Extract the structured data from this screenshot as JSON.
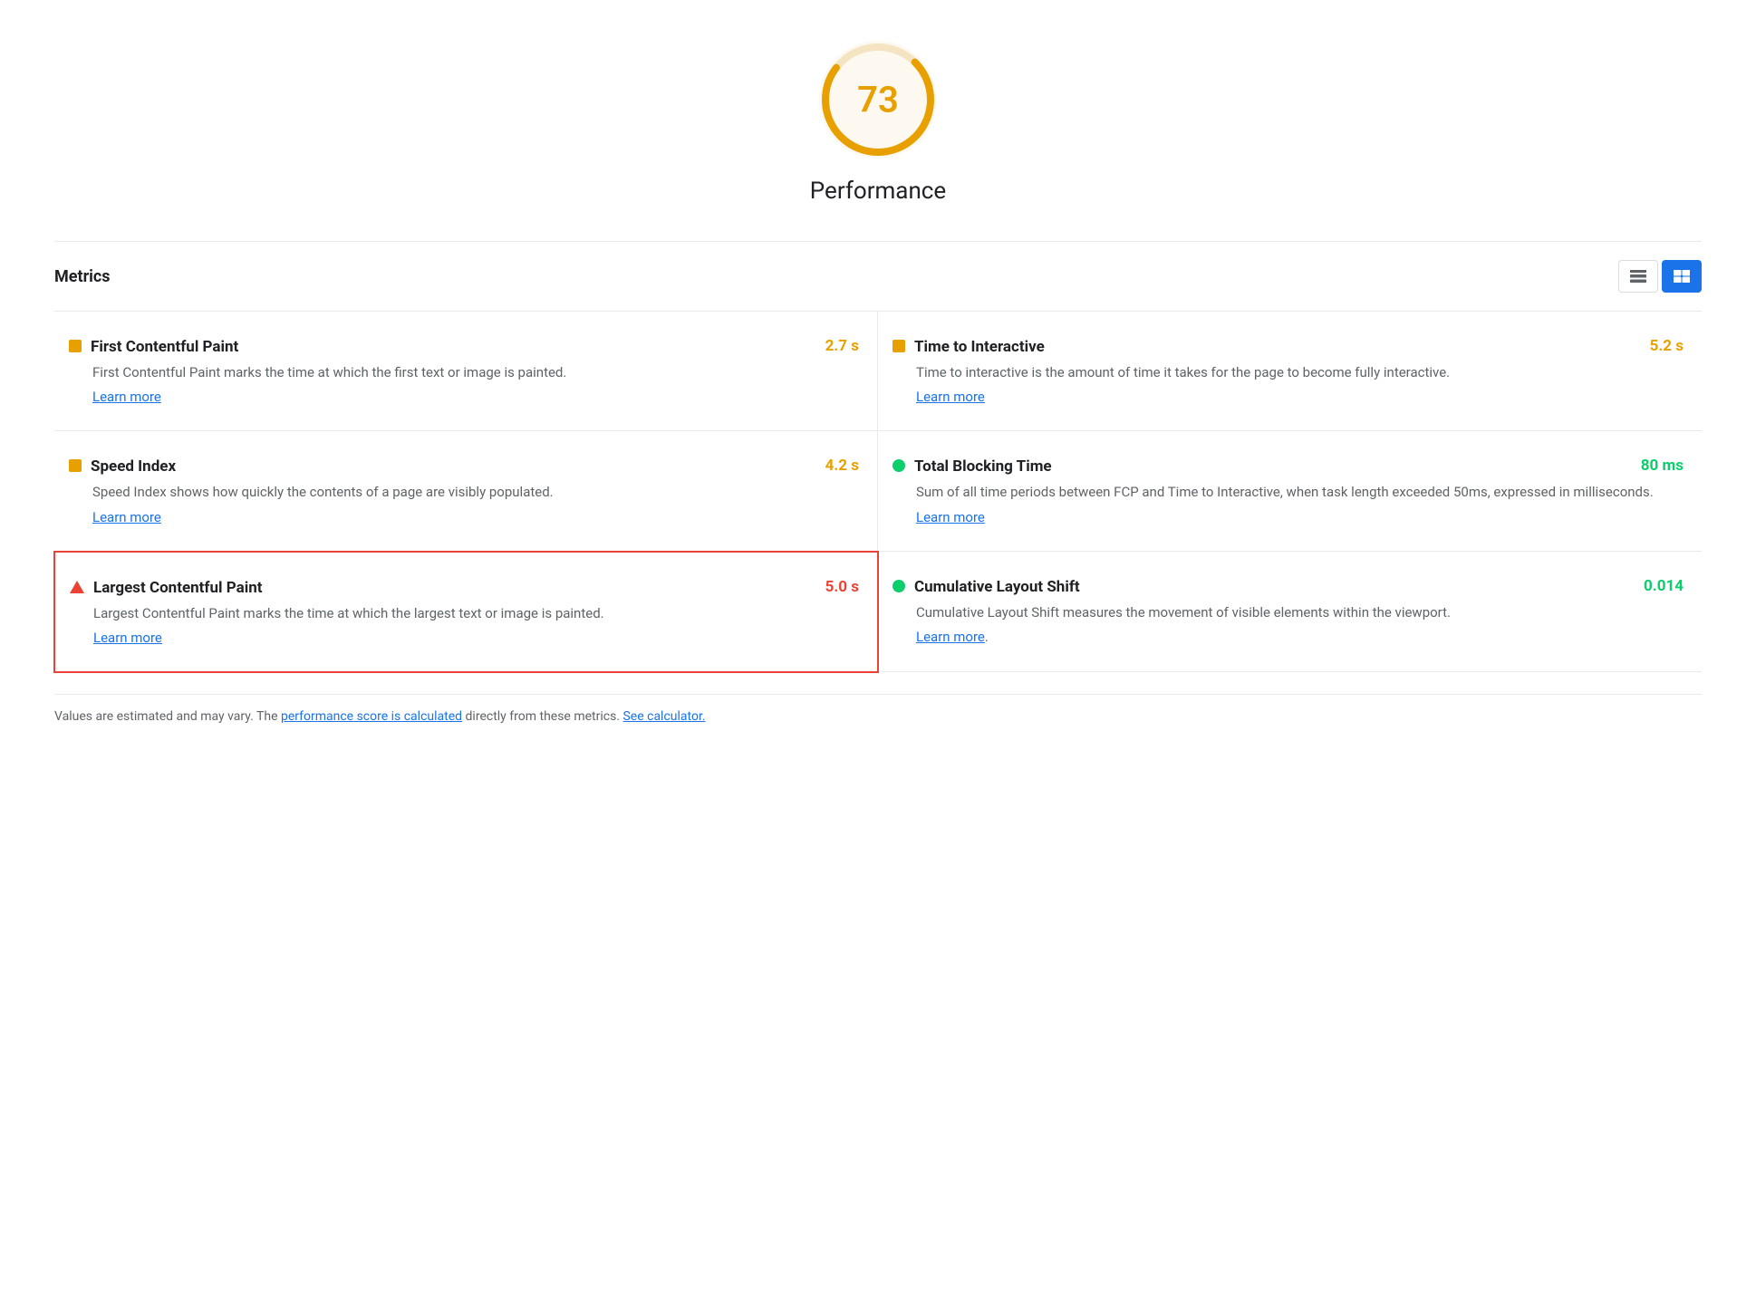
{
  "score": {
    "value": "73",
    "label": "Performance",
    "color": "#e8a000",
    "arc_percent": 73
  },
  "metrics_section": {
    "title": "Metrics",
    "toggle_list_label": "List view",
    "toggle_detail_label": "Detail view"
  },
  "metrics": [
    {
      "id": "fcp",
      "name": "First Contentful Paint",
      "value": "2.7 s",
      "value_color": "orange",
      "icon_type": "square",
      "icon_color": "#e8a000",
      "description": "First Contentful Paint marks the time at which the first text or image is painted.",
      "link_text": "Learn more",
      "highlighted": false
    },
    {
      "id": "tti",
      "name": "Time to Interactive",
      "value": "5.2 s",
      "value_color": "orange",
      "icon_type": "square",
      "icon_color": "#e8a000",
      "description": "Time to interactive is the amount of time it takes for the page to become fully interactive.",
      "link_text": "Learn more",
      "highlighted": false
    },
    {
      "id": "si",
      "name": "Speed Index",
      "value": "4.2 s",
      "value_color": "orange",
      "icon_type": "square",
      "icon_color": "#e8a000",
      "description": "Speed Index shows how quickly the contents of a page are visibly populated.",
      "link_text": "Learn more",
      "highlighted": false
    },
    {
      "id": "tbt",
      "name": "Total Blocking Time",
      "value": "80 ms",
      "value_color": "green",
      "icon_type": "circle",
      "icon_color": "#0cce6b",
      "description": "Sum of all time periods between FCP and Time to Interactive, when task length exceeded 50ms, expressed in milliseconds.",
      "link_text": "Learn more",
      "highlighted": false
    },
    {
      "id": "lcp",
      "name": "Largest Contentful Paint",
      "value": "5.0 s",
      "value_color": "red",
      "icon_type": "triangle",
      "icon_color": "#ea4335",
      "description": "Largest Contentful Paint marks the time at which the largest text or image is painted.",
      "link_text": "Learn more",
      "highlighted": true
    },
    {
      "id": "cls",
      "name": "Cumulative Layout Shift",
      "value": "0.014",
      "value_color": "green",
      "icon_type": "circle",
      "icon_color": "#0cce6b",
      "description": "Cumulative Layout Shift measures the movement of visible elements within the viewport.",
      "link_text": "Learn more",
      "highlighted": false
    }
  ],
  "footer": {
    "text_before": "Values are estimated and may vary. The ",
    "link1_text": "performance score is calculated",
    "text_middle": " directly from these metrics. ",
    "link2_text": "See calculator.",
    "text_after": ""
  }
}
